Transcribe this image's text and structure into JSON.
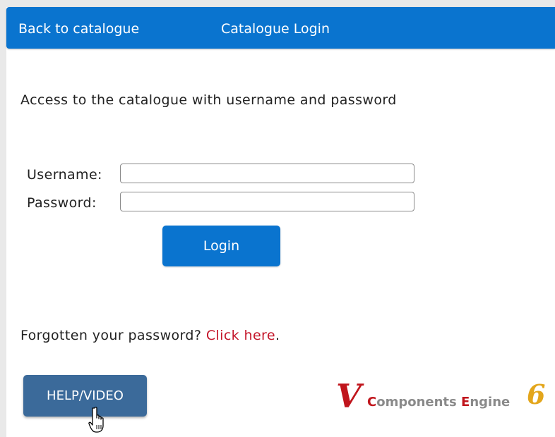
{
  "nav": {
    "back_label": "Back to catalogue",
    "login_label": "Catalogue Login"
  },
  "intro_text": "Access to the catalogue with username and password",
  "form": {
    "username_label": "Username:",
    "username_value": "",
    "password_label": "Password:",
    "password_value": "",
    "login_button": "Login"
  },
  "forgot": {
    "text": "Forgotten your password?",
    "link_text": "Click here",
    "suffix": "."
  },
  "help_button": "HELP/VIDEO",
  "logo": {
    "letter_v": "V",
    "word1_cap": "C",
    "word1_rest": "omponents",
    "word2_cap": "E",
    "word2_rest": "ngine",
    "version": "6"
  },
  "colors": {
    "topbar": "#0a74cf",
    "login_button": "#0a74cf",
    "help_button": "#3b6a9a",
    "link": "#c4162a",
    "logo_red": "#c0151c",
    "logo_gold": "#e3a61c"
  },
  "icons": {
    "cursor": "hand-pointer-icon"
  }
}
